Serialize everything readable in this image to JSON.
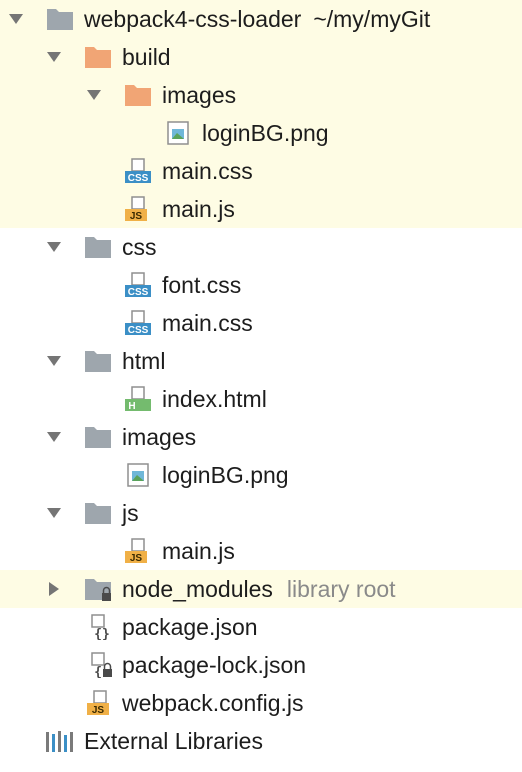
{
  "project": {
    "name": "webpack4-css-loader",
    "path": "~/my/myGit"
  },
  "tree": {
    "build": {
      "label": "build",
      "images": {
        "label": "images",
        "loginbg": "loginBG.png"
      },
      "main_css": "main.css",
      "main_js": "main.js"
    },
    "css": {
      "label": "css",
      "font_css": "font.css",
      "main_css": "main.css"
    },
    "html": {
      "label": "html",
      "index_html": "index.html"
    },
    "images": {
      "label": "images",
      "loginbg": "loginBG.png"
    },
    "js": {
      "label": "js",
      "main_js": "main.js"
    },
    "node_modules": {
      "label": "node_modules",
      "tag": "library root"
    },
    "package_json": "package.json",
    "package_lock_json": "package-lock.json",
    "webpack_config": "webpack.config.js",
    "external_libraries": "External Libraries"
  },
  "icon_badges": {
    "css": "CSS",
    "js": "JS",
    "html": "H"
  },
  "colors": {
    "highlight": "#fefce4",
    "folder_gray": "#9ea6ad",
    "folder_orange": "#f1a575",
    "css_badge": "#3b8fc6",
    "js_badge": "#f0b047",
    "html_badge": "#74bb6e",
    "secondary_text": "#8a8a8a"
  }
}
